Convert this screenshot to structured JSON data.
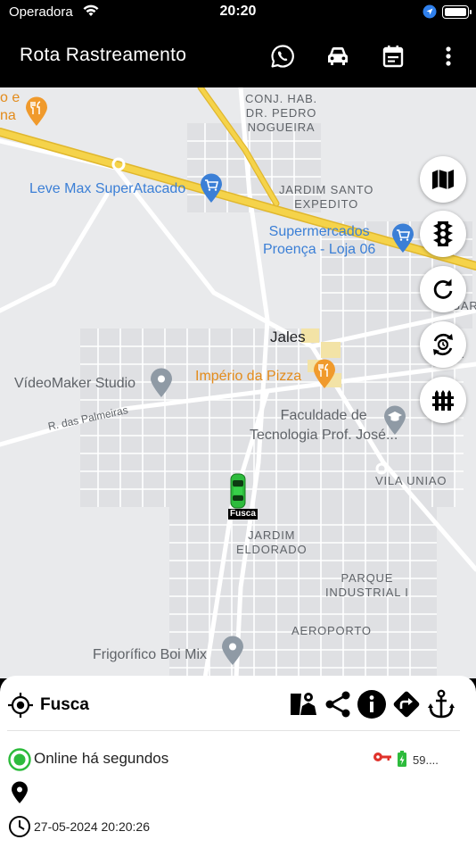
{
  "status_bar": {
    "carrier": "Operadora",
    "time": "20:20"
  },
  "app_bar": {
    "title": "Rota Rastreamento",
    "actions": [
      "whatsapp-icon",
      "car-icon",
      "calendar-icon",
      "more-vert-icon"
    ]
  },
  "map": {
    "labels": {
      "restaurant_partial": "o e\nna",
      "conj_hab": "CONJ. HAB.\nDR. PEDRO\nNOGUEIRA",
      "leve_max": "Leve Max SuperAtacado",
      "jardim_santo": "JARDIM SANTO\nEXPEDITO",
      "supermercados": "Supermercados\nProença - Loja 06",
      "jales": "Jales",
      "gar": "GAR",
      "ja": "JA",
      "videomaker": "VídeoMaker Studio",
      "imperio": "Império da Pizza",
      "palmeiras": "R. das Palmeiras",
      "faculdade": "Faculdade de\nTecnologia Prof. José...",
      "vila_uniao": "VILA UNIAO",
      "jardim_eldorado": "JARDIM\nELDORADO",
      "parque_industrial": "PARQUE\nINDUSTRIAL I",
      "aeroporto": "AEROPORTO",
      "frigorifico": "Frigorífico Boi Mix"
    },
    "controls": [
      "map-type-icon",
      "traffic-icon",
      "refresh-icon",
      "auto-refresh-icon",
      "fence-icon"
    ],
    "vehicle_marker_label": "Fusca"
  },
  "panel": {
    "vehicle_name": "Fusca",
    "tools": [
      "street-view-icon",
      "share-icon",
      "info-icon",
      "directions-icon",
      "anchor-icon"
    ],
    "status": "Online há segundos",
    "voltage": "59....",
    "datetime": "27-05-2024 20:20:26"
  },
  "colors": {
    "online": "#2dbb3c",
    "ignition_key": "#e0322b",
    "battery": "#2dbb3c",
    "highway": "#f5d34a",
    "poi_blue": "#3b7fd6",
    "poi_orange": "#f09a2c"
  }
}
